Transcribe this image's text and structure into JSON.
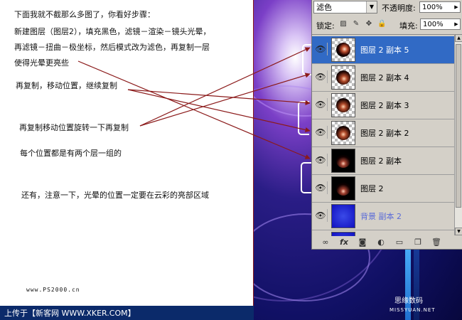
{
  "instructions": {
    "line1": "下面我就不截那么多图了，你看好步骤：",
    "line2": "新建图层（图层2），填充黑色，滤镜－渲染－镜头光晕，",
    "line3": "再滤镜－扭曲－极坐标，然后模式改为滤色，再复制一层",
    "line4": "使得光晕更亮些",
    "note1": "再复制，移动位置，继续复制",
    "note2": "再复制移动位置旋转一下再复制",
    "note3": "每个位置都是有两个层一组的",
    "note4": "还有，注意一下，光晕的位置一定要在云彩的亮部区域"
  },
  "footer": {
    "site": "www.PS2000.cn",
    "upload": "上传于【新客网 WWW.XKER.COM】"
  },
  "watermark": {
    "brand": "思缘数码",
    "url": "MISSYUAN.NET"
  },
  "layers_panel": {
    "blend_mode": "滤色",
    "opacity_label": "不透明度:",
    "opacity_value": "100%",
    "lock_label": "锁定:",
    "fill_label": "填充:",
    "fill_value": "100%",
    "layers": [
      {
        "name": "图层 2 副本 5",
        "selected": true
      },
      {
        "name": "图层 2 副本 4",
        "selected": false
      },
      {
        "name": "图层 2 副本 3",
        "selected": false
      },
      {
        "name": "图层 2 副本 2",
        "selected": false
      },
      {
        "name": "图层 2 副本",
        "selected": false
      },
      {
        "name": "图层 2",
        "selected": false
      },
      {
        "name": "背景 副本 2",
        "selected": false
      }
    ],
    "footer_icons": [
      "link-icon",
      "fx-icon",
      "mask-icon",
      "adjustment-icon",
      "folder-icon",
      "new-layer-icon",
      "trash-icon"
    ]
  },
  "colors": {
    "arrow": "#8b1a1a",
    "selected_row": "#316ac5",
    "panel_bg": "#d4d0c8"
  }
}
